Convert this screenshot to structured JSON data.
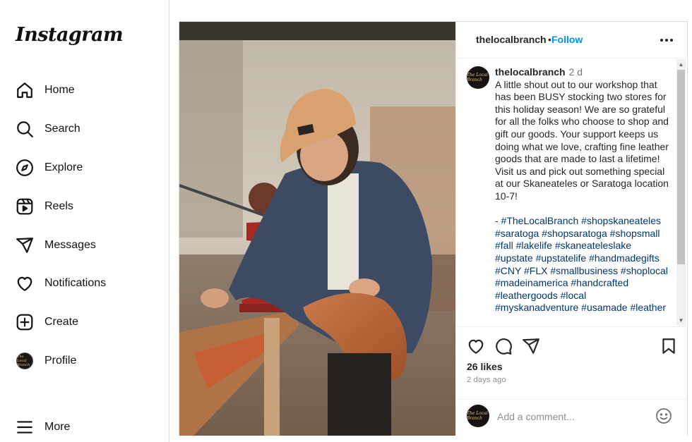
{
  "sidebar": {
    "logo": "Instagram",
    "items": [
      {
        "label": "Home",
        "icon": "home-icon"
      },
      {
        "label": "Search",
        "icon": "search-icon"
      },
      {
        "label": "Explore",
        "icon": "compass-icon"
      },
      {
        "label": "Reels",
        "icon": "reels-icon"
      },
      {
        "label": "Messages",
        "icon": "paper-plane-icon"
      },
      {
        "label": "Notifications",
        "icon": "heart-icon"
      },
      {
        "label": "Create",
        "icon": "plus-square-icon"
      },
      {
        "label": "Profile",
        "icon": "avatar"
      }
    ],
    "more_label": "More"
  },
  "post": {
    "header": {
      "username": "thelocalbranch",
      "separator": "•",
      "follow_label": "Follow"
    },
    "caption": {
      "username": "thelocalbranch",
      "time": "2 d",
      "text": "A little shout out to our workshop that has been BUSY stocking two stores for this holiday season! We are so grateful for all the folks who choose to shop and gift our goods. Your support keeps us doing what we love, crafting fine leather goods that are made to last a lifetime!",
      "text2": "Visit us and pick out something special at our Skaneateles or Saratoga location 10-7!",
      "tags": "- #TheLocalBranch #shopskaneateles #saratoga #shopsaratoga #shopsmall #fall #lakelife #skaneateleslake #upstate #upstatelife #handmadegifts #CNY #FLX #smallbusiness #shoplocal #madeinamerica #handcrafted #leathergoods #local #myskanadventure #usamade #leather"
    },
    "likes": "26 likes",
    "ago": "2 days ago",
    "comment_placeholder": "Add a comment...",
    "avatar_text": "The Local Branch"
  },
  "colors": {
    "accent": "#0095f6",
    "hashtag": "#00376b",
    "border": "#dbdbdb"
  }
}
